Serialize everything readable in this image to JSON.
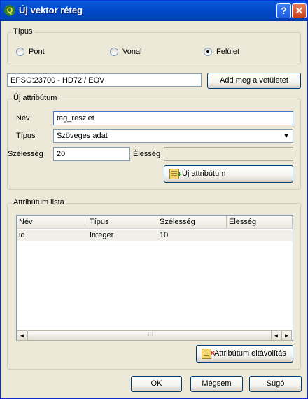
{
  "window": {
    "title": "Új vektor réteg",
    "logo": "Q",
    "help_label": "?",
    "close_label": "✕"
  },
  "type_group": {
    "legend": "Típus",
    "options": [
      {
        "label": "Pont",
        "checked": false
      },
      {
        "label": "Vonal",
        "checked": false
      },
      {
        "label": "Felület",
        "checked": true
      }
    ]
  },
  "crs": {
    "value": "EPSG:23700 - HD72 / EOV",
    "button_label": "Add meg a vetületet"
  },
  "new_attribute": {
    "legend": "Új attribútum",
    "name_label": "Név",
    "name_value": "tag_reszlet",
    "type_label": "Típus",
    "type_value": "Szöveges adat",
    "width_label": "Szélesség",
    "width_value": "20",
    "precision_label": "Élesség",
    "precision_value": "",
    "add_button_label": "Új attribútum"
  },
  "attribute_list": {
    "legend": "Attribútum lista",
    "columns": [
      "Név",
      "Típus",
      "Szélesség",
      "Élesség"
    ],
    "rows": [
      {
        "name": "id",
        "type": "Integer",
        "width": "10",
        "precision": ""
      }
    ],
    "remove_button_label": "Attribútum eltávolítás"
  },
  "footer": {
    "ok_label": "OK",
    "cancel_label": "Mégsem",
    "help_label": "Súgó"
  },
  "colors": {
    "title_bar": "#0049c8",
    "dialog_bg": "#ece9d8",
    "close_button": "#c8411a",
    "selected_row": "#f0f0e8"
  },
  "icons": {
    "scroll_left": "◄",
    "scroll_right": "►",
    "combo_arrow": "▼",
    "thumb_grip": "⁝⁝⁝"
  }
}
